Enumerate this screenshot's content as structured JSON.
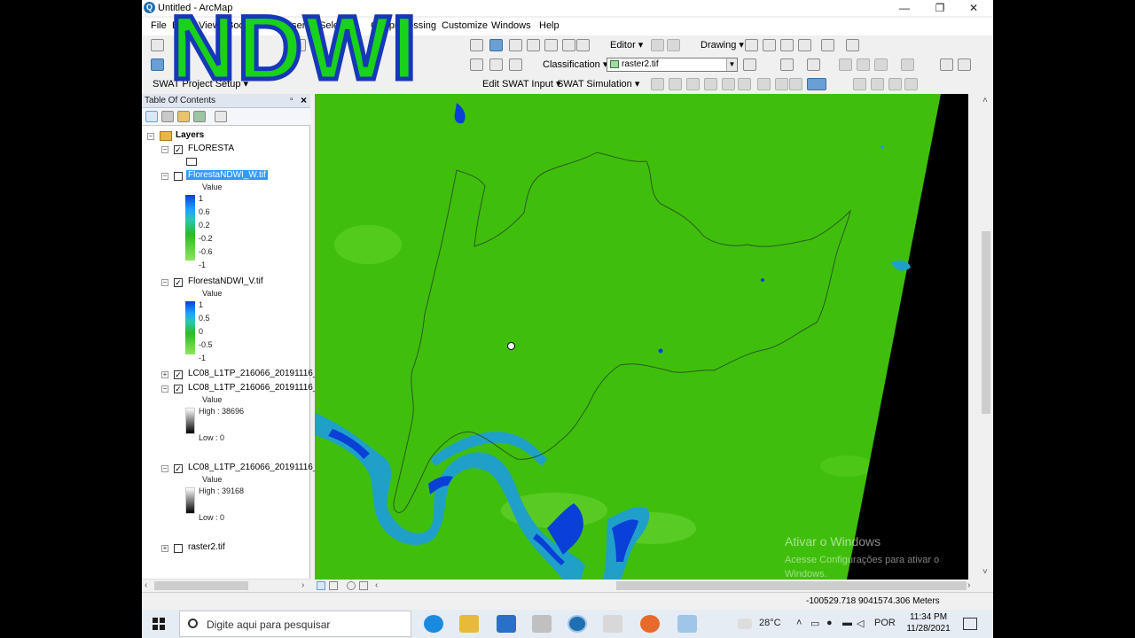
{
  "overlay_title": "NDWI",
  "window": {
    "title": "Untitled - ArcMap",
    "minimize": "—",
    "maximize": "❐",
    "close": "✕"
  },
  "menu": [
    "File",
    "Edit",
    "View",
    "Bookmarks",
    "Insert",
    "Selection",
    "Geoprocessing",
    "Customize",
    "Windows",
    "Help"
  ],
  "toolbar": {
    "editor": "Editor ▾",
    "drawing": "Drawing ▾",
    "classification": "Classification ▾",
    "raster_combo": "raster2.tif",
    "swat_setup": "SWAT Project Setup ▾",
    "edit_swat_input": "Edit SWAT Input ▾",
    "swat_simulation": "SWAT Simulation ▾"
  },
  "toc": {
    "title": "Table Of Contents",
    "pin": "▫",
    "close": "×",
    "root": "Layers",
    "value_label": "Value",
    "layers": [
      {
        "name": "FLORESTA",
        "checked": true
      },
      {
        "name": "FlorestaNDWI_W.tif",
        "checked": false,
        "selected": true,
        "values": [
          "1",
          "0.6",
          "0.2",
          "-0.2",
          "-0.6",
          "-1"
        ]
      },
      {
        "name": "FlorestaNDWI_V.tif",
        "checked": true,
        "values": [
          "1",
          "0.5",
          "0",
          "-0.5",
          "-1"
        ]
      },
      {
        "name": "LC08_L1TP_216066_20191116_2",
        "checked": true
      },
      {
        "name": "LC08_L1TP_216066_20191116_2",
        "checked": true,
        "high": "High : 38696",
        "low": "Low : 0"
      },
      {
        "name": "LC08_L1TP_216066_20191116_2",
        "checked": true,
        "high": "High : 39168",
        "low": "Low : 0"
      },
      {
        "name": "raster2.tif",
        "checked": false
      }
    ]
  },
  "status": {
    "coords": "-100529.718  9041574.306 Meters"
  },
  "watermark": {
    "line1": "Ativar o Windows",
    "line2": "Acesse Configurações para ativar o",
    "line3": "Windows."
  },
  "taskbar": {
    "search_placeholder": "Digite aqui para pesquisar",
    "temperature": "28°C",
    "language": "POR",
    "time": "11:34 PM",
    "date": "11/28/2021"
  },
  "colors": {
    "vegetation": "#3fbf0c",
    "water_deep": "#0a3fd8",
    "water_shallow": "#1fa0c8",
    "nodata": "#000000"
  }
}
